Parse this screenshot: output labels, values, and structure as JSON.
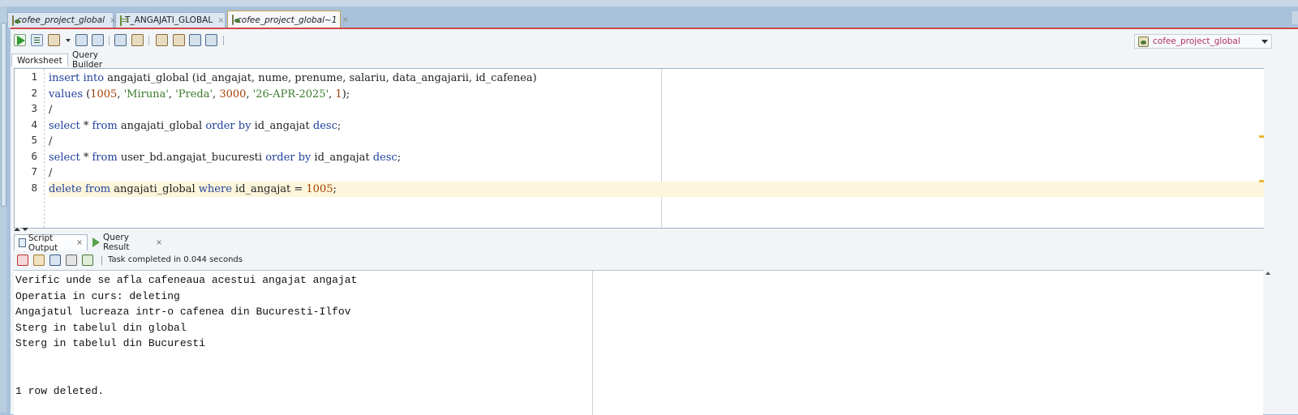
{
  "editor_tabs": [
    {
      "label": "cofee_project_global",
      "italic": true,
      "active": false,
      "icon": "database-icon"
    },
    {
      "label": "T_ANGAJATI_GLOBAL",
      "italic": false,
      "active": false,
      "icon": "table-icon"
    },
    {
      "label": "cofee_project_global~1",
      "italic": true,
      "active": true,
      "icon": "database-icon"
    }
  ],
  "close_glyph": "×",
  "connection": {
    "name": "cofee_project_global",
    "icon": "database-icon"
  },
  "sub_tabs": {
    "worksheet": "Worksheet",
    "query_builder": "Query Builder"
  },
  "code_lines": [
    {
      "n": "1",
      "tokens": [
        [
          "kw",
          "insert"
        ],
        [
          "t",
          " "
        ],
        [
          "kw",
          "into"
        ],
        [
          "t",
          " angajati_global (id_angajat, nume, prenume, salariu, data_angajarii, id_cafenea)"
        ]
      ]
    },
    {
      "n": "2",
      "tokens": [
        [
          "kw",
          "values"
        ],
        [
          "t",
          " ("
        ],
        [
          "num",
          "1005"
        ],
        [
          "t",
          ", "
        ],
        [
          "str",
          "'Miruna'"
        ],
        [
          "t",
          ", "
        ],
        [
          "str",
          "'Preda'"
        ],
        [
          "t",
          ", "
        ],
        [
          "num",
          "3000"
        ],
        [
          "t",
          ", "
        ],
        [
          "str",
          "'26-APR-2025'"
        ],
        [
          "t",
          ", "
        ],
        [
          "num",
          "1"
        ],
        [
          "t",
          ");"
        ]
      ]
    },
    {
      "n": "3",
      "tokens": [
        [
          "t",
          "/"
        ]
      ]
    },
    {
      "n": "4",
      "tokens": [
        [
          "kw",
          "select"
        ],
        [
          "t",
          " * "
        ],
        [
          "kw",
          "from"
        ],
        [
          "t",
          " angajati_global "
        ],
        [
          "kw",
          "order by"
        ],
        [
          "t",
          " id_angajat "
        ],
        [
          "kw",
          "desc"
        ],
        [
          "t",
          ";"
        ]
      ]
    },
    {
      "n": "5",
      "tokens": [
        [
          "t",
          "/"
        ]
      ]
    },
    {
      "n": "6",
      "tokens": [
        [
          "kw",
          "select"
        ],
        [
          "t",
          " * "
        ],
        [
          "kw",
          "from"
        ],
        [
          "t",
          " user_bd.angajat_bucuresti "
        ],
        [
          "kw",
          "order by"
        ],
        [
          "t",
          " id_angajat "
        ],
        [
          "kw",
          "desc"
        ],
        [
          "t",
          ";"
        ]
      ]
    },
    {
      "n": "7",
      "tokens": [
        [
          "t",
          "/"
        ]
      ]
    },
    {
      "n": "8",
      "tokens": [
        [
          "kw",
          "delete"
        ],
        [
          "t",
          " "
        ],
        [
          "kw",
          "from"
        ],
        [
          "t",
          " angajati_global "
        ],
        [
          "kw",
          "where"
        ],
        [
          "t",
          " id_angajat = "
        ],
        [
          "num",
          "1005"
        ],
        [
          "t",
          ";"
        ]
      ],
      "highlight": true
    }
  ],
  "output_tabs": [
    {
      "label": "Script Output",
      "active": true,
      "icon": "script-output-icon"
    },
    {
      "label": "Query Result",
      "active": false,
      "icon": "play-icon"
    }
  ],
  "status": "Task completed in 0.044 seconds",
  "output_lines": [
    "Verific unde se afla cafeneaua acestui angajat angajat",
    "Operatia in curs: deleting",
    "Angajatul lucreaza intr-o cafenea din Bucuresti-Ilfov",
    "Sterg in tabelul din global",
    "Sterg in tabelul din Bucuresti",
    "",
    "",
    "1 row deleted."
  ],
  "colors": {
    "keyword": "#1f3f9c",
    "string": "#3a7a2a",
    "number": "#a04000",
    "active_tab_border": "#c9a24a",
    "panel_accent": "#d04848"
  }
}
